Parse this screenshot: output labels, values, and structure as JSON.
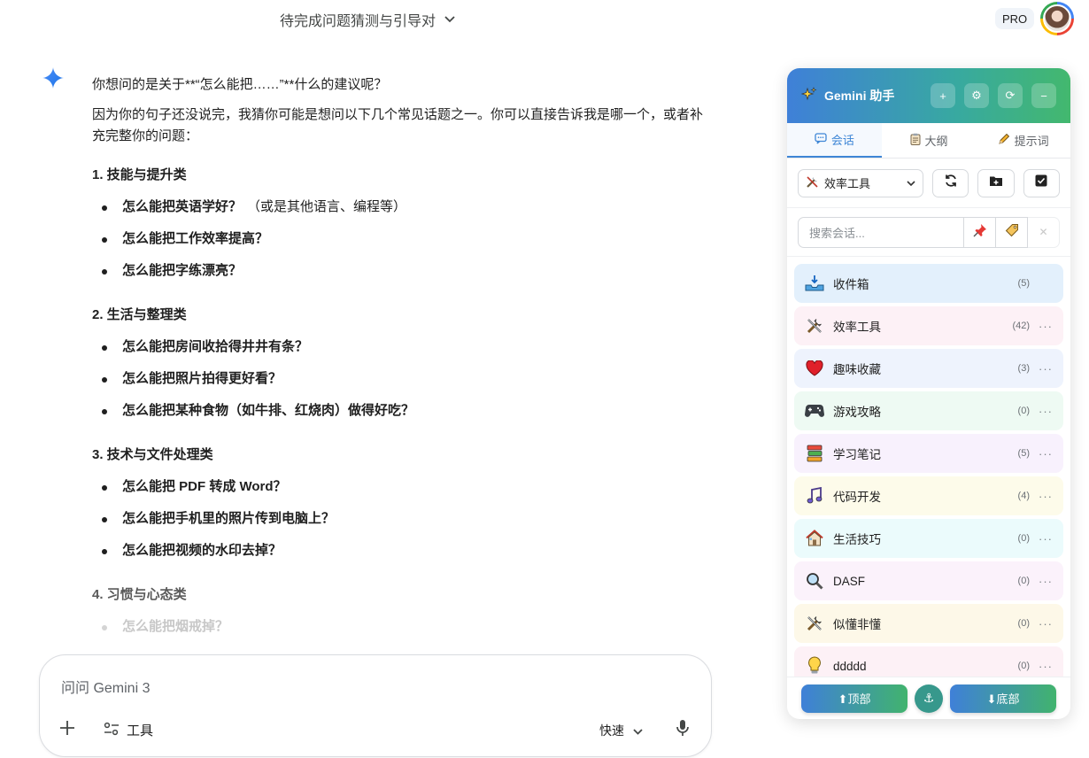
{
  "header": {
    "conversation_title": "待完成问题猜测与引导对",
    "pro_label": "PRO"
  },
  "chat": {
    "intro": "你想问的是关于**“怎么能把……”**什么的建议呢？",
    "followup": "因为你的句子还没说完，我猜你可能是想问以下几个常见话题之一。你可以直接告诉我是哪一个，或者补充完整你的问题：",
    "sections": [
      {
        "heading": "1. 技能与提升类",
        "items": [
          {
            "text": "怎么能把英语学好？",
            "note": "（或是其他语言、编程等）"
          },
          {
            "text": "怎么能把工作效率提高？",
            "note": ""
          },
          {
            "text": "怎么能把字练漂亮？",
            "note": ""
          }
        ]
      },
      {
        "heading": "2. 生活与整理类",
        "items": [
          {
            "text": "怎么能把房间收拾得井井有条？",
            "note": ""
          },
          {
            "text": "怎么能把照片拍得更好看？",
            "note": ""
          },
          {
            "text": "怎么能把某种食物（如牛排、红烧肉）做得好吃？",
            "note": ""
          }
        ]
      },
      {
        "heading": "3. 技术与文件处理类",
        "items": [
          {
            "text": "怎么能把 PDF 转成 Word？",
            "note": ""
          },
          {
            "text": "怎么能把手机里的照片传到电脑上？",
            "note": ""
          },
          {
            "text": "怎么能把视频的水印去掉？",
            "note": ""
          }
        ]
      },
      {
        "heading": "4. 习惯与心态类",
        "items": [
          {
            "text": "怎么能把烟戒掉？",
            "note": ""
          }
        ]
      }
    ]
  },
  "input": {
    "placeholder": "问问 Gemini 3",
    "tools_label": "工具",
    "speed_label": "快速"
  },
  "panel": {
    "title": "Gemini 助手",
    "tabs": [
      {
        "label": "会话",
        "icon": "chat-icon"
      },
      {
        "label": "大纲",
        "icon": "clipboard-icon"
      },
      {
        "label": "提示词",
        "icon": "pencil-icon"
      }
    ],
    "folder_select": "效率工具",
    "search_placeholder": "搜索会话...",
    "folders": [
      {
        "name": "收件箱",
        "count": "(5)",
        "icon": "inbox-icon",
        "bg": "#e3f0fc",
        "more": ""
      },
      {
        "name": "效率工具",
        "count": "(42)",
        "icon": "tools-icon",
        "bg": "#fdf1f6",
        "more": "···"
      },
      {
        "name": "趣味收藏",
        "count": "(3)",
        "icon": "heart-icon",
        "bg": "#eef3fd",
        "more": "···"
      },
      {
        "name": "游戏攻略",
        "count": "(0)",
        "icon": "gamepad-icon",
        "bg": "#eefaf3",
        "more": "···"
      },
      {
        "name": "学习笔记",
        "count": "(5)",
        "icon": "books-icon",
        "bg": "#f8f1fd",
        "more": "···"
      },
      {
        "name": "代码开发",
        "count": "(4)",
        "icon": "music-icon",
        "bg": "#fdfbea",
        "more": "···"
      },
      {
        "name": "生活技巧",
        "count": "(0)",
        "icon": "house-icon",
        "bg": "#ebfbfc",
        "more": "···"
      },
      {
        "name": "DASF",
        "count": "(0)",
        "icon": "magnifier-icon",
        "bg": "#fbf2fb",
        "more": "···"
      },
      {
        "name": "似懂非懂",
        "count": "(0)",
        "icon": "tools-icon",
        "bg": "#fdf8e8",
        "more": "···"
      },
      {
        "name": "ddddd",
        "count": "(0)",
        "icon": "bulb-icon",
        "bg": "#fdf1f6",
        "more": "···"
      }
    ],
    "footer": {
      "top_label": "⬆顶部",
      "bottom_label": "⬇底部"
    },
    "colors": {
      "accent": "#3e86d6",
      "gradient_start": "#3f80d8",
      "gradient_end": "#43b86e"
    }
  }
}
